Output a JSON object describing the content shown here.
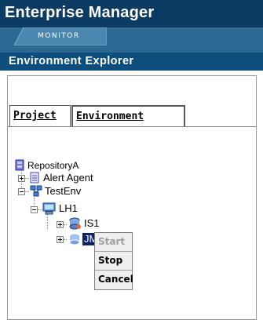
{
  "app": {
    "title": "Enterprise Manager"
  },
  "tabs": {
    "monitor": "MONITOR"
  },
  "panel": {
    "title": "Environment Explorer"
  },
  "explorer_tabs": {
    "project": "Project",
    "environment": "Environment"
  },
  "tree": {
    "root": "RepositoryA",
    "alert_agent": "Alert Agent",
    "test_env": "TestEnv",
    "lh1": "LH1",
    "is1": "IS1",
    "jms1": "JMS1"
  },
  "context_menu": {
    "start": "Start",
    "stop": "Stop",
    "cancel": "Cancel"
  },
  "colors": {
    "titlebar": "#0b3b62",
    "tabstrip": "#2c6a94",
    "panel_header": "#0d4e7c",
    "selection": "#0a246a"
  }
}
